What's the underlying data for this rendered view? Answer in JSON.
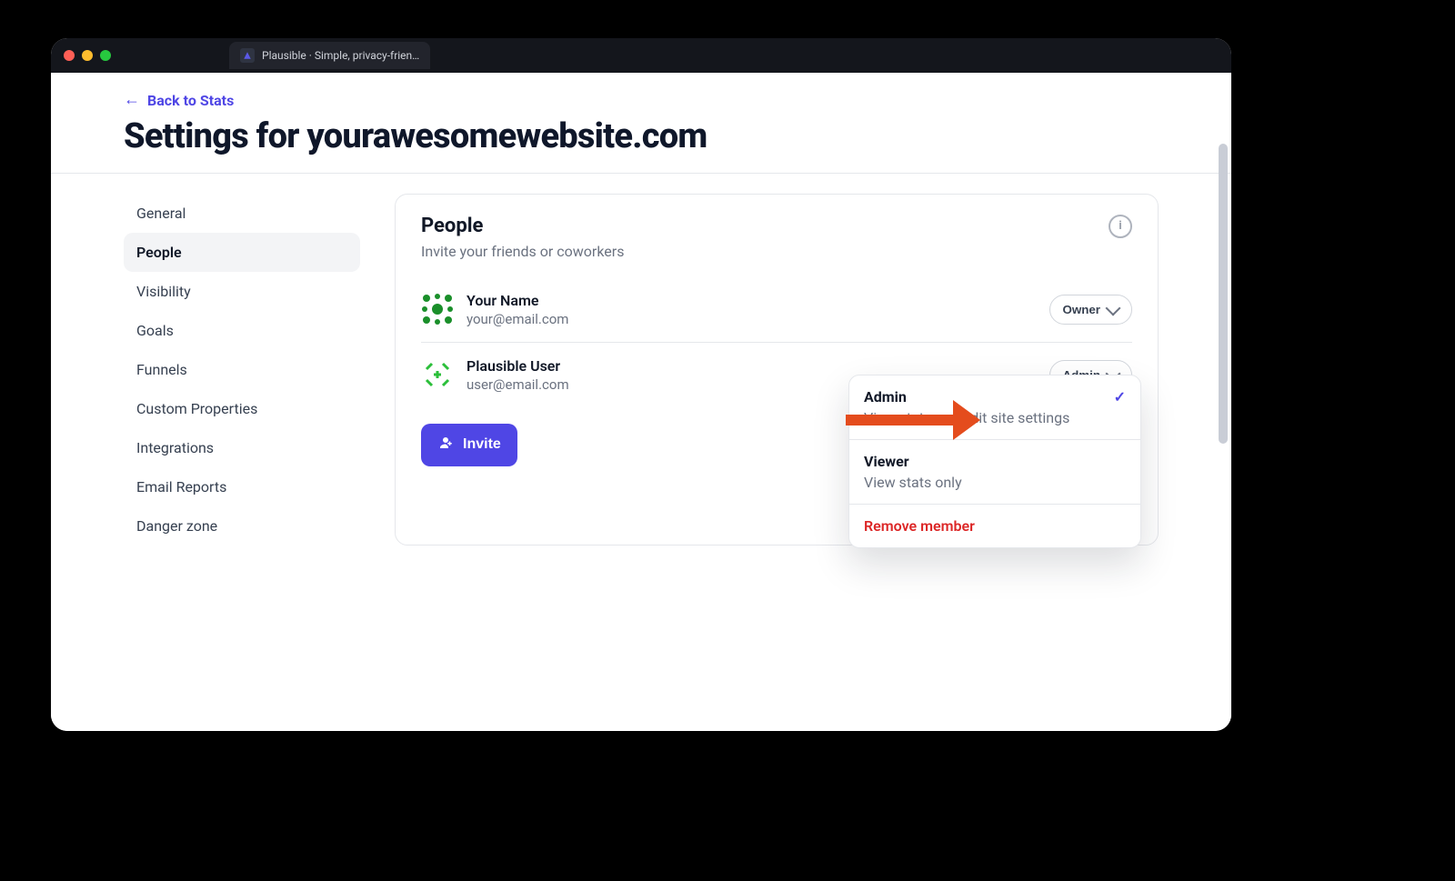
{
  "window": {
    "tab_title": "Plausible · Simple, privacy-frien…"
  },
  "header": {
    "back_label": "Back to Stats",
    "page_title": "Settings for yourawesomewebsite.com"
  },
  "sidebar": {
    "items": [
      {
        "label": "General"
      },
      {
        "label": "People",
        "active": true
      },
      {
        "label": "Visibility"
      },
      {
        "label": "Goals"
      },
      {
        "label": "Funnels"
      },
      {
        "label": "Custom Properties"
      },
      {
        "label": "Integrations"
      },
      {
        "label": "Email Reports"
      },
      {
        "label": "Danger zone"
      }
    ]
  },
  "people": {
    "title": "People",
    "subtitle": "Invite your friends or coworkers",
    "invite_label": "Invite",
    "members": [
      {
        "name": "Your Name",
        "email": "your@email.com",
        "role": "Owner"
      },
      {
        "name": "Plausible User",
        "email": "user@email.com",
        "role": "Admin"
      }
    ]
  },
  "role_menu": {
    "options": [
      {
        "title": "Admin",
        "desc": "View stats and edit site settings",
        "selected": true
      },
      {
        "title": "Viewer",
        "desc": "View stats only"
      }
    ],
    "remove_label": "Remove member"
  }
}
